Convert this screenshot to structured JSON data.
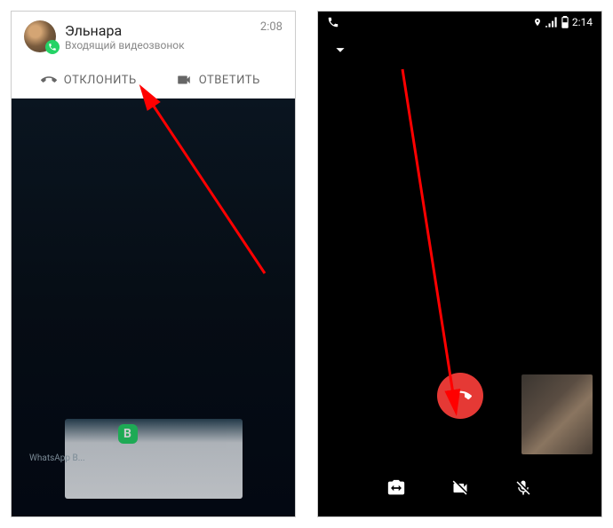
{
  "left": {
    "caller_name": "Эльнара",
    "call_type": "Входящий видеозвонок",
    "time": "2:08",
    "decline_label": "ОТКЛОНИТЬ",
    "answer_label": "ОТВЕТИТЬ",
    "bg_app_label": "WhatsApp B...",
    "wa_badge_letter": "B"
  },
  "right": {
    "status_time": "2:14"
  },
  "icons": {
    "phone_decline": "phone-hangup-icon",
    "video": "video-icon",
    "phone_small": "phone-icon",
    "location": "location-icon",
    "signal": "signal-icon",
    "battery": "battery-icon",
    "chevron": "chevron-down-icon",
    "end_call": "end-call-icon",
    "camera_switch": "camera-switch-icon",
    "video_off": "video-off-icon",
    "mic_off": "mic-off-icon"
  },
  "colors": {
    "end_call": "#e53935",
    "whatsapp": "#25d366",
    "arrow": "#ff0000"
  }
}
